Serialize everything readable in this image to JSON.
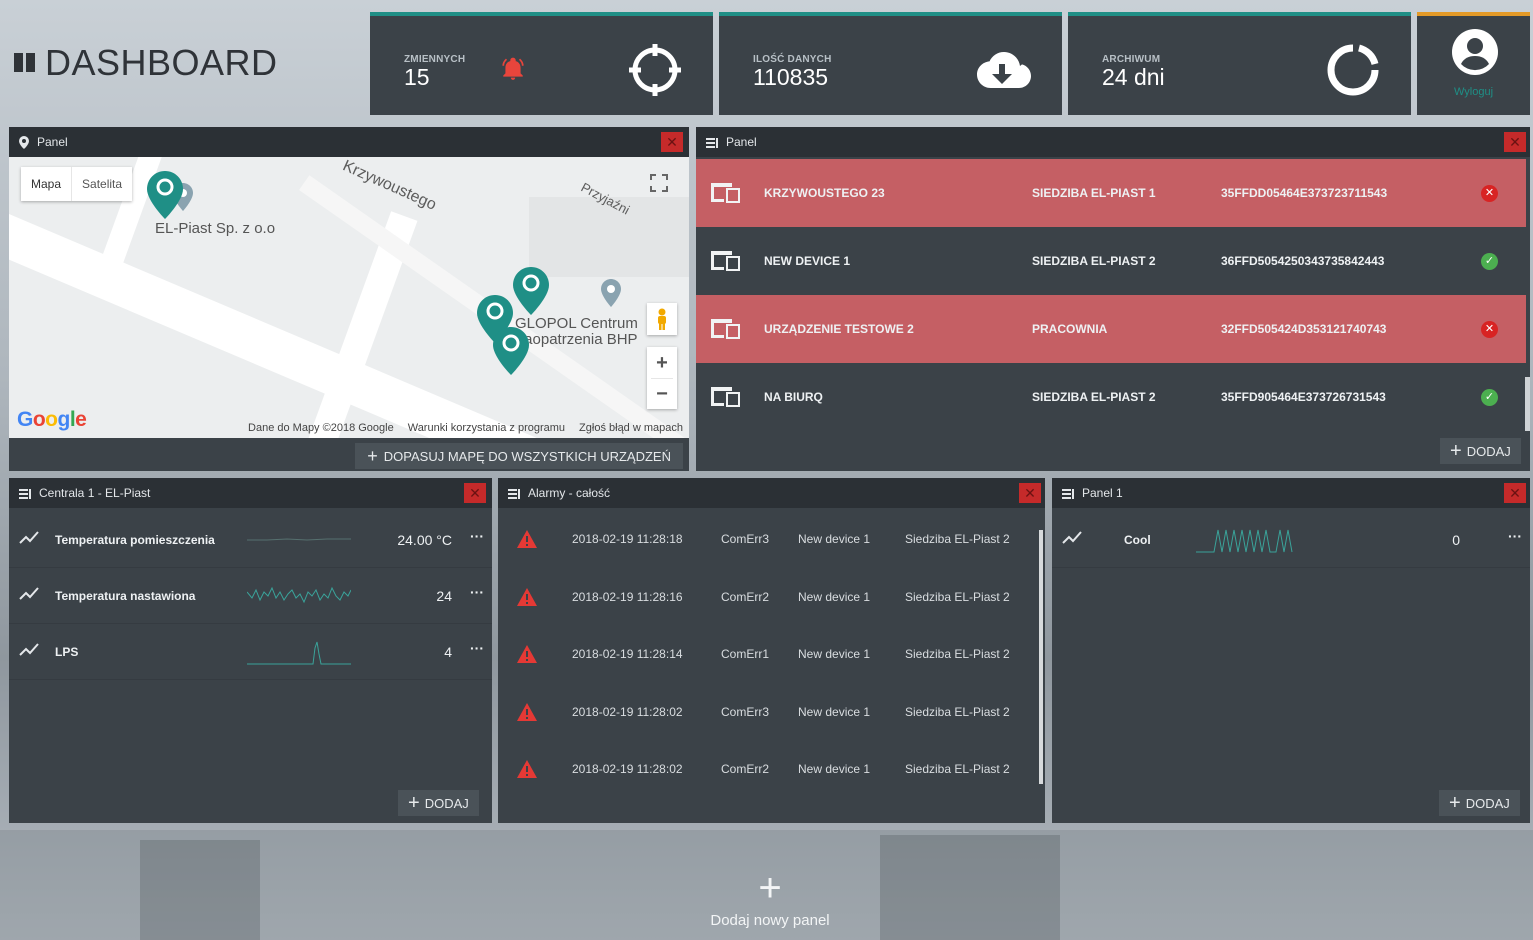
{
  "header": {
    "title": "DASHBOARD"
  },
  "stats": {
    "variables": {
      "label": "ZMIENNYCH",
      "value": "15"
    },
    "data_count": {
      "label": "ILOŚĆ DANYCH",
      "value": "110835"
    },
    "archive": {
      "label": "ARCHIWUM",
      "value": "24 dni"
    },
    "logout_label": "Wyloguj"
  },
  "map_panel": {
    "title": "Panel",
    "map_types": [
      "Mapa",
      "Satelita"
    ],
    "streets": [
      "Krzywoustego",
      "Przyjaźni"
    ],
    "places": [
      "EL-Piast Sp. z o.o",
      "GLOPOL Centrum",
      "Zaopatrzenia BHP"
    ],
    "google_logo": "Google",
    "footer": [
      "Dane do Mapy ©2018 Google",
      "Warunki korzystania z programu",
      "Zgłoś błąd w mapach"
    ],
    "fit_button": "DOPASUJ MAPĘ DO WSZYSTKICH URZĄDZEŃ"
  },
  "device_panel": {
    "title": "Panel",
    "rows": [
      {
        "name": "KRZYWOUSTEGO 23",
        "site": "SIEDZIBA EL-PIAST 1",
        "id": "35FFDD05464E373723711543",
        "status": "error"
      },
      {
        "name": "NEW DEVICE 1",
        "site": "SIEDZIBA EL-PIAST 2",
        "id": "36FFD5054250343735842443",
        "status": "ok"
      },
      {
        "name": "URZĄDZENIE TESTOWE 2",
        "site": "PRACOWNIA",
        "id": "32FFD505424D353121740743",
        "status": "error"
      },
      {
        "name": "NA BIURQ",
        "site": "SIEDZIBA EL-PIAST 2",
        "id": "35FFD905464E373726731543",
        "status": "ok"
      }
    ],
    "add_label": "DODAJ"
  },
  "sensor_panel": {
    "title": "Centrala 1 - EL-Piast",
    "rows": [
      {
        "name": "Temperatura pomieszczenia",
        "value": "24.00 °C",
        "more": "···"
      },
      {
        "name": "Temperatura nastawiona",
        "value": "24",
        "more": "···"
      },
      {
        "name": "LPS",
        "value": "4",
        "more": "···"
      }
    ],
    "add_label": "DODAJ"
  },
  "alarm_panel": {
    "title": "Alarmy - całość",
    "rows": [
      {
        "time": "2018-02-19 11:28:18",
        "code": "ComErr3",
        "device": "New device 1",
        "site": "Siedziba EL-Piast 2"
      },
      {
        "time": "2018-02-19 11:28:16",
        "code": "ComErr2",
        "device": "New device 1",
        "site": "Siedziba EL-Piast 2"
      },
      {
        "time": "2018-02-19 11:28:14",
        "code": "ComErr1",
        "device": "New device 1",
        "site": "Siedziba EL-Piast 2"
      },
      {
        "time": "2018-02-19 11:28:02",
        "code": "ComErr3",
        "device": "New device 1",
        "site": "Siedziba EL-Piast 2"
      },
      {
        "time": "2018-02-19 11:28:02",
        "code": "ComErr2",
        "device": "New device 1",
        "site": "Siedziba EL-Piast 2"
      }
    ]
  },
  "panel1": {
    "title": "Panel 1",
    "rows": [
      {
        "name": "Cool",
        "value": "0",
        "more": "···"
      }
    ],
    "add_label": "DODAJ"
  },
  "add_panel": {
    "plus": "+",
    "label": "Dodaj nowy panel"
  },
  "colors": {
    "accent": "#1f8f86",
    "error_row": "#c55f64",
    "panel_bg": "#3b4248",
    "header_bg": "#2b3035",
    "logout_accent": "#e39a28"
  },
  "icons": {
    "bell": "bell-icon",
    "crosshair": "crosshair-icon",
    "cloud_download": "cloud-download-icon",
    "refresh": "refresh-icon",
    "account": "account-icon",
    "map_pin": "map-pin-icon",
    "list": "list-icon",
    "device": "device-icon",
    "chart": "trend-line-icon",
    "warning": "warning-icon"
  }
}
